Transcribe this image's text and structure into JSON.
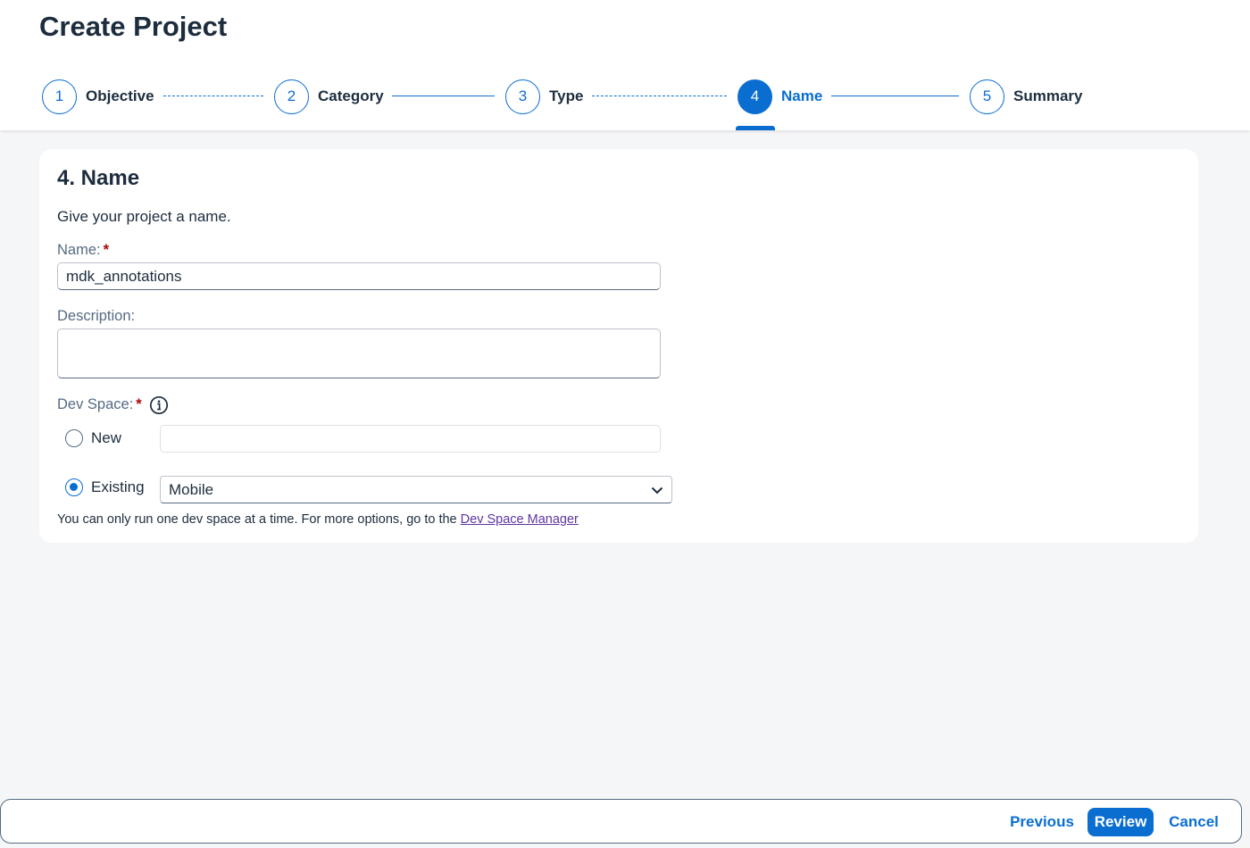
{
  "page": {
    "title": "Create Project"
  },
  "wizard": {
    "steps": [
      {
        "number": "1",
        "label": "Objective"
      },
      {
        "number": "2",
        "label": "Category"
      },
      {
        "number": "3",
        "label": "Type"
      },
      {
        "number": "4",
        "label": "Name"
      },
      {
        "number": "5",
        "label": "Summary"
      }
    ],
    "active_step": "4"
  },
  "form": {
    "section_title": "4. Name",
    "intro": "Give your project a name.",
    "name": {
      "label": "Name:",
      "required_mark": "*",
      "value": "mdk_annotations"
    },
    "description": {
      "label": "Description:",
      "value": ""
    },
    "dev_space": {
      "label": "Dev Space:",
      "required_mark": "*",
      "info_icon": "info-icon",
      "new_option_label": "New",
      "new_value": "",
      "existing_option_label": "Existing",
      "existing_selected": "Mobile",
      "selected_option": "Existing",
      "helper_text": "You can only run one dev space at a time. For more options, go to the",
      "helper_link": "Dev Space Manager"
    }
  },
  "footer": {
    "previous": "Previous",
    "review": "Review",
    "cancel": "Cancel"
  },
  "colors": {
    "accent": "#0a6ed1",
    "required": "#aa0808",
    "link": "#5d36a1",
    "background": "#f5f6f7"
  }
}
